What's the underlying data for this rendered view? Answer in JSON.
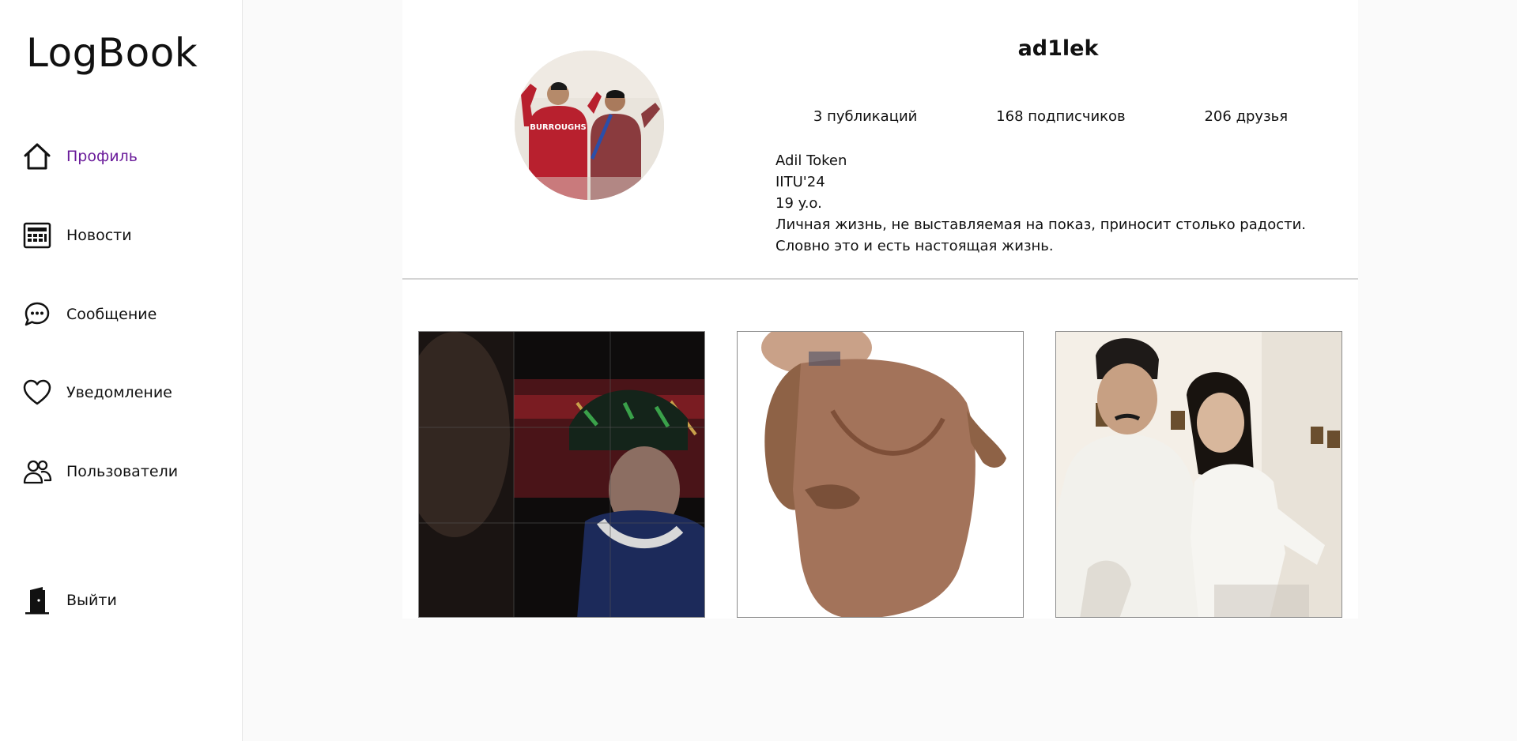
{
  "app": {
    "logo": "LogBook"
  },
  "sidebar": {
    "items": [
      {
        "label": "Профиль",
        "icon": "home-icon",
        "active": true
      },
      {
        "label": "Новости",
        "icon": "newspaper-icon",
        "active": false
      },
      {
        "label": "Сообщение",
        "icon": "chat-bubble-icon",
        "active": false
      },
      {
        "label": "Уведомление",
        "icon": "heart-icon",
        "active": false
      },
      {
        "label": "Пользователи",
        "icon": "users-icon",
        "active": false
      },
      {
        "label": "Выйти",
        "icon": "door-icon",
        "active": false
      }
    ]
  },
  "profile": {
    "username": "ad1lek",
    "stats": {
      "posts": "3 публикаций",
      "followers": "168 подписчиков",
      "friends": "206 друзья"
    },
    "bio": {
      "name": "Adil Token",
      "line2": "IITU'24",
      "line3": "19 y.o.",
      "line4": "Личная жизнь, не выставляемая на показ, приносит столько радости. Словно это и есть настоящая жизнь."
    }
  },
  "colors": {
    "active": "#6a1b9a",
    "background": "#fafafa",
    "divider": "#d4d4d4"
  }
}
